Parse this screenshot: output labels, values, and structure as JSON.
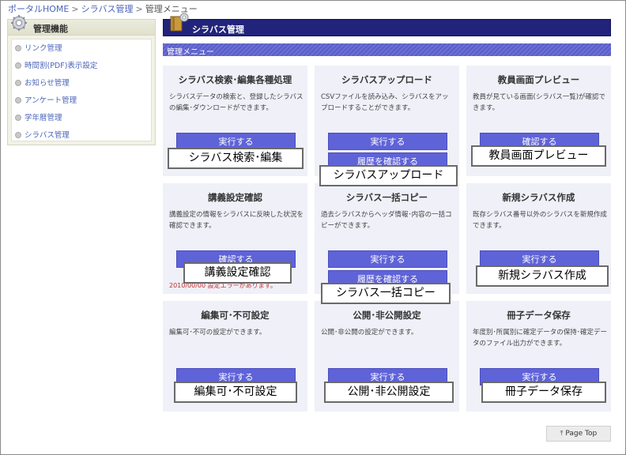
{
  "breadcrumb": {
    "home": "ポータルHOME",
    "syllabus": "シラバス管理",
    "current": "管理メニュー",
    "sep": ">"
  },
  "sidebar": {
    "title": "管理機能",
    "items": [
      {
        "label": "リンク管理"
      },
      {
        "label": "時間割(PDF)表示設定"
      },
      {
        "label": "お知らせ管理"
      },
      {
        "label": "アンケート管理"
      },
      {
        "label": "学年暦管理"
      },
      {
        "label": "シラバス管理"
      }
    ]
  },
  "header": {
    "title": "シラバス管理",
    "submenu": "管理メニュー"
  },
  "cards": [
    {
      "title": "シラバス検索･編集各種処理",
      "desc": "シラバスデータの検索と、登録したシラバスの編集･ダウンロードができます。",
      "buttons": [
        "実行する"
      ],
      "callout": "シラバス検索･編集"
    },
    {
      "title": "シラバスアップロード",
      "desc": "CSVファイルを読み込み、シラバスをアップロードすることができます。",
      "buttons": [
        "実行する",
        "履歴を確認する"
      ],
      "callout": "シラバスアップロード"
    },
    {
      "title": "教員画面プレビュー",
      "desc": "教員が見ている画面(シラバス一覧)が確認できます。",
      "buttons": [
        "確認する"
      ],
      "callout": "教員画面プレビュー"
    },
    {
      "title": "講義設定確認",
      "desc": "講義設定の情報をシラバスに反映した状況を確認できます。",
      "buttons": [
        "確認する"
      ],
      "callout": "講義設定確認",
      "stray": "2010/00/00 設定エラーがあります。"
    },
    {
      "title": "シラバス一括コピー",
      "desc": "過去シラバスからヘッダ情報･内容の一括コピーができます。",
      "buttons": [
        "実行する",
        "履歴を確認する"
      ],
      "callout": "シラバス一括コピー"
    },
    {
      "title": "新規シラバス作成",
      "desc": "既存シラバス番号以外のシラバスを新規作成できます。",
      "buttons": [
        "実行する"
      ],
      "callout": "新規シラバス作成"
    },
    {
      "title": "編集可･不可設定",
      "desc": "編集可･不可の設定ができます。",
      "buttons": [
        "実行する"
      ],
      "callout": "編集可･不可設定"
    },
    {
      "title": "公開･非公開設定",
      "desc": "公開･非公開の設定ができます。",
      "buttons": [
        "実行する"
      ],
      "callout": "公開･非公開設定"
    },
    {
      "title": "冊子データ保存",
      "desc": "年度別･所属別に確定データの保持･確定データのファイル出力ができます。",
      "buttons": [
        "実行する"
      ],
      "callout": "冊子データ保存"
    }
  ],
  "page_top": {
    "label": "Page Top",
    "arrow": "⤒"
  }
}
